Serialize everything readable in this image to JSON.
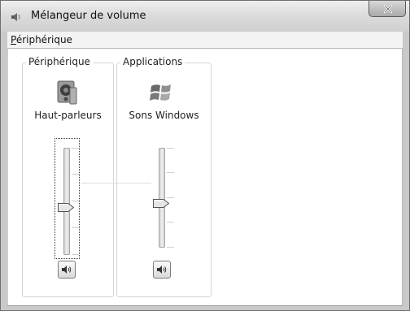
{
  "window": {
    "title": "Mélangeur de volume",
    "icons": {
      "app": "speaker-mixer-icon",
      "close": "close-icon"
    }
  },
  "menubar": {
    "items": [
      {
        "label_underlined": "P",
        "label_rest": "ériphérique"
      }
    ]
  },
  "device_group": {
    "legend": "Périphérique",
    "channel": {
      "label": "Haut-parleurs",
      "icon": "speakers-icon",
      "volume_percent": 45,
      "muted": false,
      "mute_icon": "speaker-volume-icon"
    }
  },
  "apps_group": {
    "legend": "Applications",
    "channels": [
      {
        "label": "Sons Windows",
        "icon": "windows-logo-icon",
        "volume_percent": 45,
        "muted": false,
        "mute_icon": "speaker-volume-icon"
      }
    ]
  },
  "colors": {
    "client_bg": "#ffffff",
    "frame_bg": "#c9c9c9"
  }
}
